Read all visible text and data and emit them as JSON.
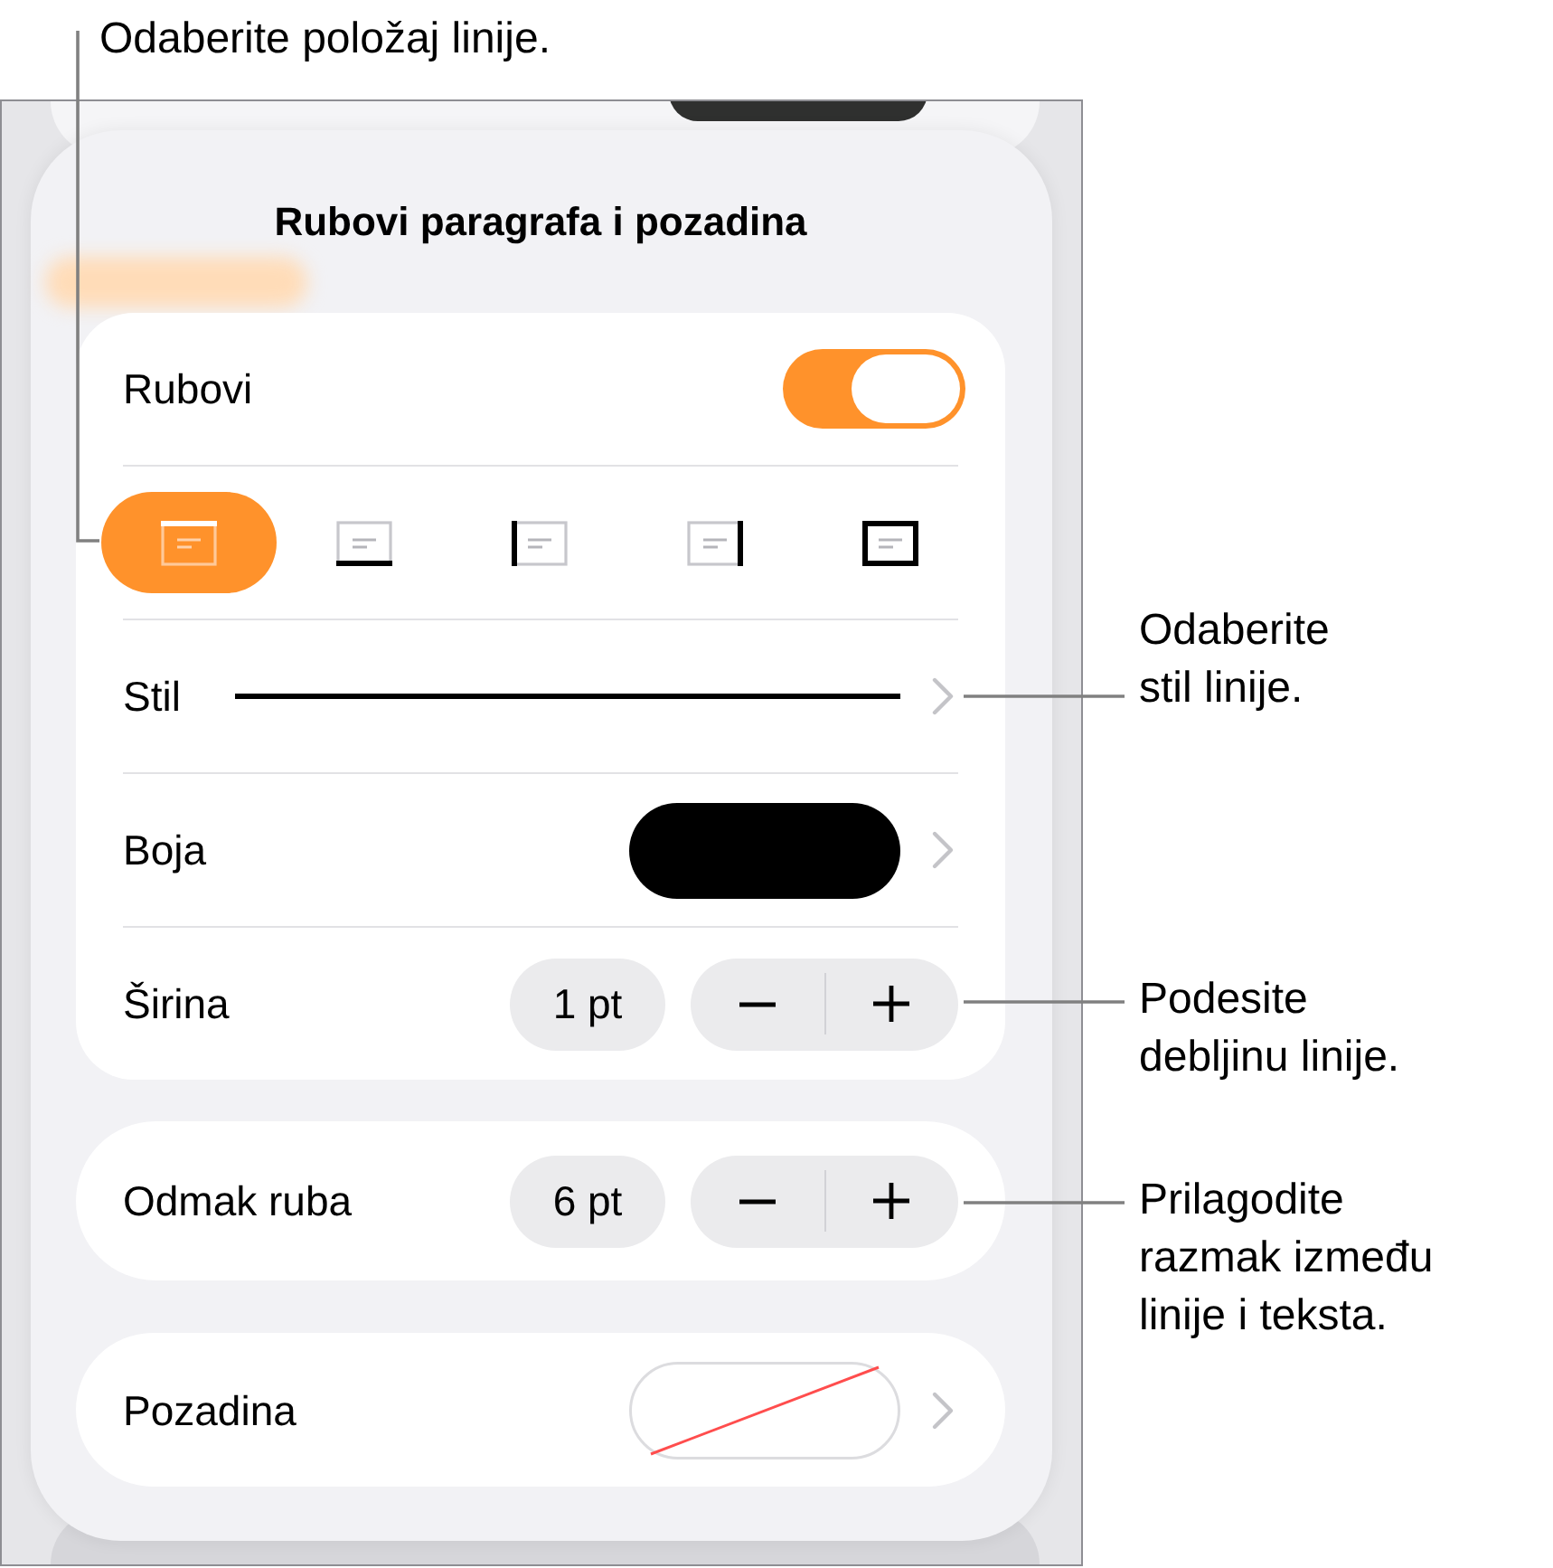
{
  "callouts": [
    {
      "lines": [
        "Odaberite položaj linije."
      ]
    },
    {
      "lines": [
        "Odaberite",
        "stil linije."
      ]
    },
    {
      "lines": [
        "Podesite",
        "debljinu linije."
      ]
    },
    {
      "lines": [
        "Prilagodite",
        "razmak između",
        "linije i teksta."
      ]
    }
  ],
  "panel": {
    "title": "Rubovi paragrafa i pozadina",
    "borders": {
      "label": "Rubovi",
      "on": true
    },
    "positions": [
      {
        "kind": "top",
        "selected": true
      },
      {
        "kind": "bottom",
        "selected": false
      },
      {
        "kind": "left",
        "selected": false
      },
      {
        "kind": "right",
        "selected": false
      },
      {
        "kind": "box",
        "selected": false
      }
    ],
    "style": {
      "label": "Stil",
      "dashed": false
    },
    "color": {
      "label": "Boja",
      "color": "#000000"
    },
    "width": {
      "label": "Širina",
      "value": "1 pt"
    },
    "offset": {
      "label": "Odmak ruba",
      "value": "6 pt"
    },
    "background": {
      "label": "Pozadina",
      "no_fill": true
    }
  }
}
